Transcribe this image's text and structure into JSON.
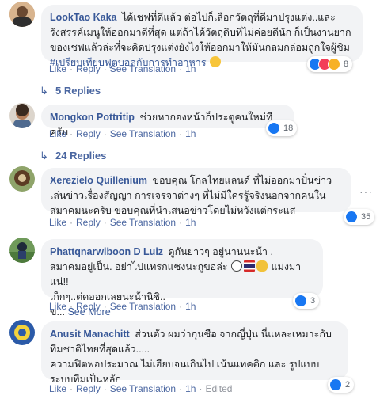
{
  "comments": [
    {
      "author": "LookTao Kaka",
      "text": "ได้เชฟที่ดีแล้ว ต่อไปก็เลือกวัตถุที่ดีมาปรุงแต่ง..และรังสรรค์เมนูให้ออกมาดีที่สุด แต่ถ้าได้วัตถุดิบที่ไม่ค่อยดีนัก ก็เป็นงานยากของเชฟแล้วล่ะที่จะคิดปรุงแต่งยังไงให้ออกมาให้มันกลมกล่อมถูกใจผู้ชิม",
      "hashtag": "#เปรียบเทียบฟุตบอลกับการทำอาหาร",
      "emoji": "grinning-face",
      "actions": [
        "Like",
        "Reply",
        "See Translation",
        "1h"
      ],
      "reaction_count": "8",
      "reactions": [
        "like-icon",
        "love-icon",
        "wow-icon"
      ],
      "replies": "5 Replies"
    },
    {
      "author": "Mongkon Pottritip",
      "text": "ช่วยหากองหน้าก็ประตูคนใหม่ทีครับ",
      "actions": [
        "Like",
        "Reply",
        "See Translation",
        "1h"
      ],
      "reaction_count": "18",
      "reactions": [
        "like-icon"
      ],
      "replies": "24 Replies"
    },
    {
      "author": "Xerezielo Quillenium",
      "text": "ขอบคุณ โกลไทยแลนด์ ที่ไม่ออกมาปั่นข่าว เล่นข่าวเรื่องสัญญา การเจรจาต่างๆ ที่ไม่มีใครรู้จริงนอกจากคนในสมาคมนะครับ ขอบคุณที่นำเสนอข่าวโดยไม่หวังแต่กระแส",
      "actions": [
        "Like",
        "Reply",
        "See Translation",
        "1h"
      ],
      "reaction_count": "35",
      "reactions": [
        "like-icon"
      ]
    },
    {
      "author": "Phattqnarwiboon D Luiz",
      "line1": "ดูกันยาวๆ อยู่นานนะน้า .",
      "line2a": "สมาคมอยู่เป็น. อย่าไปแทรกแซงนะกูขอล่ะ",
      "line2b": "แม่งมาแน่!!",
      "line3": "เก็กๆ..ต่ดออกเลยนะน้านิชิ..",
      "line4": "ข...",
      "see_more": "See More",
      "emojis": [
        "soccer-ball-icon",
        "thai-flag-icon",
        "flexed-biceps-icon"
      ],
      "actions": [
        "Like",
        "Reply",
        "See Translation",
        "1h"
      ],
      "reaction_count": "3",
      "reactions": [
        "like-icon"
      ]
    },
    {
      "author": "Anusit Manachitt",
      "text": "ส่วนตัว ผมว่ากุนซือ จากญี่ปุ่น นี่แหละเหมาะกับทีมชาติไทยที่สุดแล้ว.....",
      "text2": "ความฟิตพอประมาณ ไม่เฮียบจนเกินไป เน้นแทคติก และ รูปแบบ ระบบทีมเป็นหลัก",
      "actions": [
        "Like",
        "Reply",
        "See Translation",
        "1h",
        "Edited"
      ],
      "reaction_count": "2",
      "reactions": [
        "like-icon"
      ]
    }
  ],
  "colors": {
    "link": "#385898",
    "bubble": "#f2f3f5",
    "like_blue": "#1877f2",
    "love_red": "#f33e58",
    "wow_yellow": "#f7b125"
  }
}
